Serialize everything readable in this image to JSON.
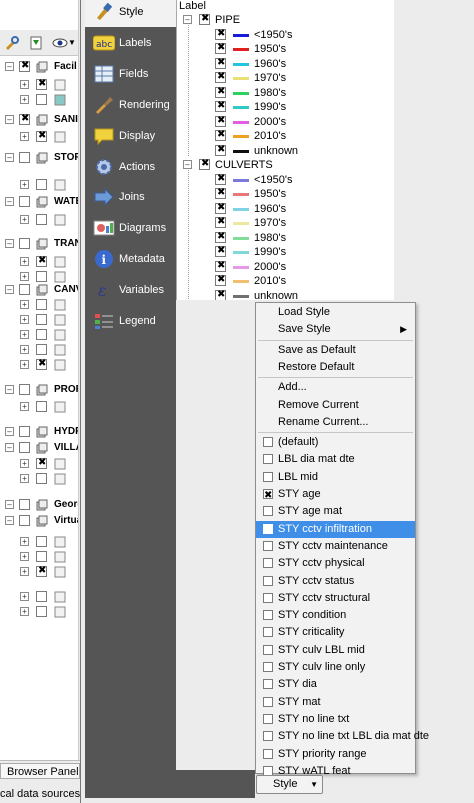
{
  "dialog_sidebar": {
    "items": [
      {
        "label": "Style",
        "icon": "paintbrush-icon",
        "active": true
      },
      {
        "label": "Labels",
        "icon": "abc-icon"
      },
      {
        "label": "Fields",
        "icon": "table-icon"
      },
      {
        "label": "Rendering",
        "icon": "brush-icon"
      },
      {
        "label": "Display",
        "icon": "speech-bubble-icon"
      },
      {
        "label": "Actions",
        "icon": "gear-icon"
      },
      {
        "label": "Joins",
        "icon": "arrow-join-icon"
      },
      {
        "label": "Diagrams",
        "icon": "diagram-icon"
      },
      {
        "label": "Metadata",
        "icon": "info-icon"
      },
      {
        "label": "Variables",
        "icon": "epsilon-icon"
      },
      {
        "label": "Legend",
        "icon": "legend-icon"
      }
    ]
  },
  "layers_panel": {
    "rows": [
      {
        "label": "Facil"
      },
      {
        "label": "SANI"
      },
      {
        "label": "STOR"
      },
      {
        "label": "WATE"
      },
      {
        "label": "TRAN"
      },
      {
        "label": "CANV"
      },
      {
        "label": "PROF"
      },
      {
        "label": "HYDR"
      },
      {
        "label": "VILLA"
      },
      {
        "label": "Geore"
      },
      {
        "label": "Virtua"
      }
    ],
    "bottom_tab": "Browser Panel",
    "bottom_status": "cal data sources"
  },
  "legend_tree": {
    "header": "Label",
    "groups": [
      {
        "name": "PIPE",
        "classes": [
          {
            "label": "<1950's",
            "color": "#1a1adc"
          },
          {
            "label": "1950's",
            "color": "#e02020"
          },
          {
            "label": "1960's",
            "color": "#22c4e0"
          },
          {
            "label": "1970's",
            "color": "#e8e070"
          },
          {
            "label": "1980's",
            "color": "#30d060"
          },
          {
            "label": "1990's",
            "color": "#30c8c8"
          },
          {
            "label": "2000's",
            "color": "#e060e0"
          },
          {
            "label": "2010's",
            "color": "#f0a020"
          },
          {
            "label": "unknown",
            "color": "#101010"
          }
        ]
      },
      {
        "name": "CULVERTS",
        "classes": [
          {
            "label": "<1950's",
            "color": "#7a7ad8"
          },
          {
            "label": "1950's",
            "color": "#e87878"
          },
          {
            "label": "1960's",
            "color": "#7ed4e4"
          },
          {
            "label": "1970's",
            "color": "#ece8a0"
          },
          {
            "label": "1980's",
            "color": "#80dc98"
          },
          {
            "label": "1990's",
            "color": "#80d8d8"
          },
          {
            "label": "2000's",
            "color": "#e898e8"
          },
          {
            "label": "2010's",
            "color": "#f0c070"
          },
          {
            "label": "unknown",
            "color": "#707070"
          }
        ]
      }
    ]
  },
  "context_menu": {
    "actions_a": [
      {
        "label": "Load Style"
      },
      {
        "label": "Save Style",
        "submenu": true
      }
    ],
    "actions_b": [
      {
        "label": "Save as Default"
      },
      {
        "label": "Restore Default"
      }
    ],
    "actions_c": [
      {
        "label": "Add..."
      },
      {
        "label": "Remove Current"
      },
      {
        "label": "Rename Current..."
      }
    ],
    "styles": [
      {
        "label": "(default)",
        "checked": false
      },
      {
        "label": "LBL dia mat dte",
        "checked": false
      },
      {
        "label": "LBL mid",
        "checked": false
      },
      {
        "label": "STY age",
        "checked": true
      },
      {
        "label": "STY age mat",
        "checked": false
      },
      {
        "label": "STY cctv infiltration",
        "checked": false,
        "highlighted": true
      },
      {
        "label": "STY cctv maintenance",
        "checked": false
      },
      {
        "label": "STY cctv physical",
        "checked": false
      },
      {
        "label": "STY cctv status",
        "checked": false
      },
      {
        "label": "STY cctv structural",
        "checked": false
      },
      {
        "label": "STY condition",
        "checked": false
      },
      {
        "label": "STY criticality",
        "checked": false
      },
      {
        "label": "STY culv LBL mid",
        "checked": false
      },
      {
        "label": "STY culv line only",
        "checked": false
      },
      {
        "label": "STY dia",
        "checked": false
      },
      {
        "label": "STY mat",
        "checked": false
      },
      {
        "label": "STY no line txt",
        "checked": false
      },
      {
        "label": "STY no line txt LBL dia mat dte",
        "checked": false
      },
      {
        "label": "STY priority range",
        "checked": false
      },
      {
        "label": "STY wATL feat",
        "checked": false
      }
    ]
  },
  "style_button": {
    "label": "Style",
    "dropdown_icon": "chevron-down-icon"
  }
}
